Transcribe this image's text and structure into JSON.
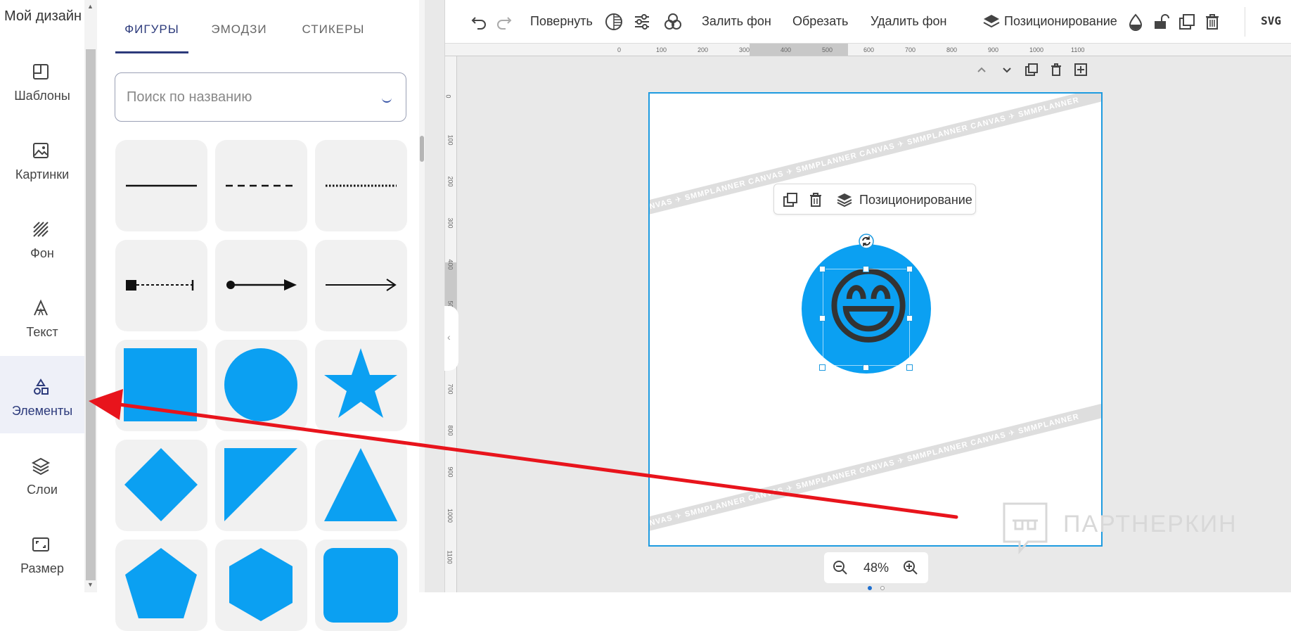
{
  "sidebar": {
    "header": "Мой дизайн",
    "items": [
      {
        "label": "Шаблоны"
      },
      {
        "label": "Картинки"
      },
      {
        "label": "Фон"
      },
      {
        "label": "Текст"
      },
      {
        "label": "Элементы",
        "active": true
      },
      {
        "label": "Слои"
      },
      {
        "label": "Размер"
      }
    ]
  },
  "panel": {
    "tabs": [
      {
        "label": "ФИГУРЫ",
        "active": true
      },
      {
        "label": "ЭМОДЗИ"
      },
      {
        "label": "СТИКЕРЫ"
      }
    ],
    "search_placeholder": "Поиск по названию",
    "shapes": [
      "solid-line",
      "dashed-line",
      "dotted-line",
      "square-dotted-connector",
      "dot-arrow",
      "arrow",
      "square",
      "circle",
      "star",
      "diamond",
      "right-triangle",
      "triangle",
      "pentagon",
      "hexagon",
      "rounded-square"
    ]
  },
  "toolbar": {
    "rotate": "Повернуть",
    "fill_bg": "Залить фон",
    "crop": "Обрезать",
    "remove_bg": "Удалить фон",
    "positioning": "Позиционирование",
    "export_format": "SVG"
  },
  "rulers": {
    "horizontal": [
      "0",
      "100",
      "200",
      "300",
      "400",
      "500",
      "600",
      "700",
      "800",
      "900",
      "1000",
      "1100"
    ],
    "vertical": [
      "0",
      "100",
      "200",
      "300",
      "400",
      "500",
      "600",
      "700",
      "800",
      "900",
      "1000",
      "1100"
    ]
  },
  "canvas": {
    "context_menu_label": "Позиционирование",
    "watermark_text": "CANVAS ✈ SMMPLANNER ",
    "emoji": "😄"
  },
  "zoom": {
    "value": "48%"
  },
  "watermark": {
    "brand": "ПАРТНЕРКИН"
  },
  "colors": {
    "accent": "#1e9be0",
    "shape_fill": "#0ba0f2",
    "nav_active": "#2c3a7b",
    "arrow": "#e8141c"
  }
}
